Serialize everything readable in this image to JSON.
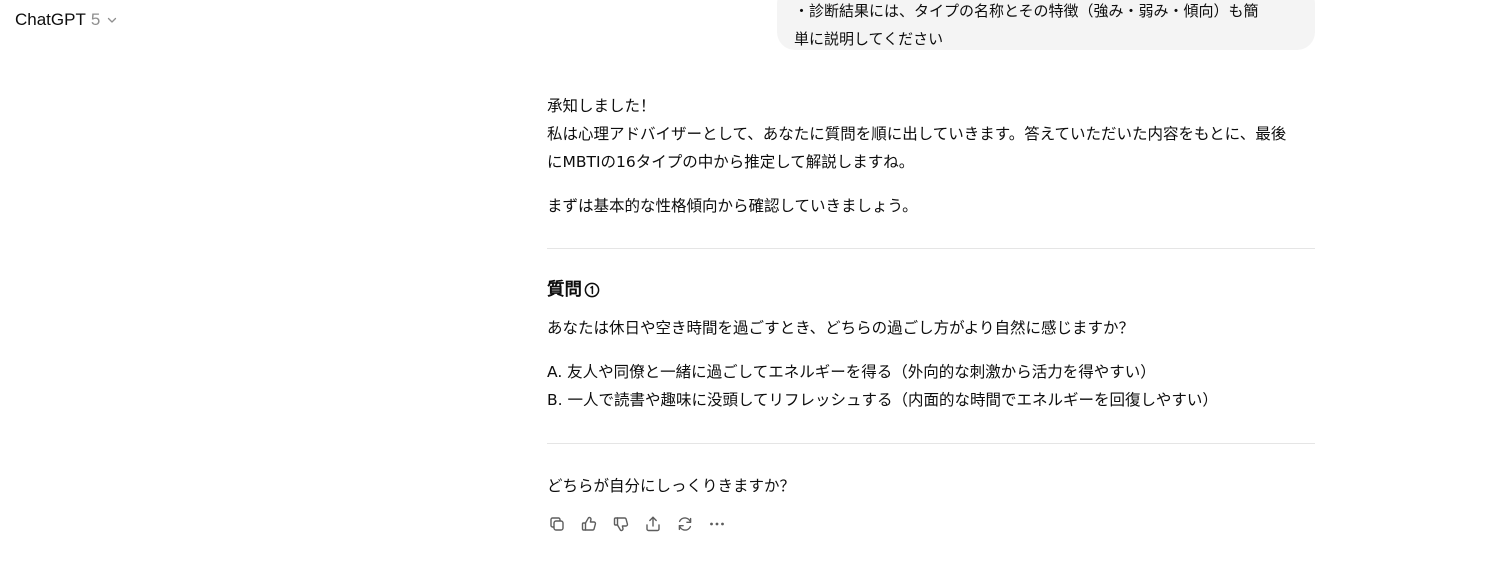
{
  "header": {
    "model_name": "ChatGPT",
    "model_version": "5",
    "dropdown_icon": "chevron-down-icon"
  },
  "user_message": {
    "lines": [
      "・診断結果には、タイプの名称とその特徴（強み・弱み・傾向）も簡",
      "単に説明してください"
    ]
  },
  "assistant_message": {
    "intro_lines": [
      "承知しました！",
      "私は心理アドバイザーとして、あなたに質問を順に出していきます。答えていただいた内容をもとに、最後",
      "にMBTIの16タイプの中から推定して解説しますね。"
    ],
    "lead": "まずは基本的な性格傾向から確認していきましょう。",
    "question_heading": "質問",
    "question_number_icon": "circled-1-icon",
    "question_text": "あなたは休日や空き時間を過ごすとき、どちらの過ごし方がより自然に感じますか？",
    "options": [
      "A. 友人や同僚と一緒に過ごしてエネルギーを得る（外向的な刺激から活力を得やすい）",
      "B. 一人で読書や趣味に没頭してリフレッシュする（内面的な時間でエネルギーを回復しやすい）"
    ],
    "closing": "どちらが自分にしっくりきますか？"
  },
  "message_actions": [
    {
      "icon": "copy-icon",
      "label": "Copy"
    },
    {
      "icon": "thumbs-up-icon",
      "label": "Good response"
    },
    {
      "icon": "thumbs-down-icon",
      "label": "Bad response"
    },
    {
      "icon": "share-icon",
      "label": "Share"
    },
    {
      "icon": "regenerate-icon",
      "label": "Regenerate"
    },
    {
      "icon": "more-icon",
      "label": "More actions"
    }
  ]
}
